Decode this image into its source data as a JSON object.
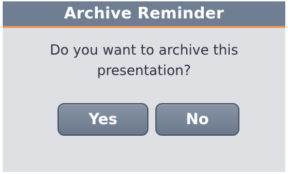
{
  "dialog": {
    "title": "Archive Reminder",
    "message_line1": "Do you want to archive this",
    "message_line2": "presentation?",
    "yes_label": "Yes",
    "no_label": "No"
  },
  "colors": {
    "title_bar": "#6f7e92",
    "title_accent": "#e99657",
    "dialog_bg": "#dfe0e4",
    "button_bg": "#7a8798",
    "button_border": "#4f5b6a",
    "message_text": "#2a3240"
  }
}
